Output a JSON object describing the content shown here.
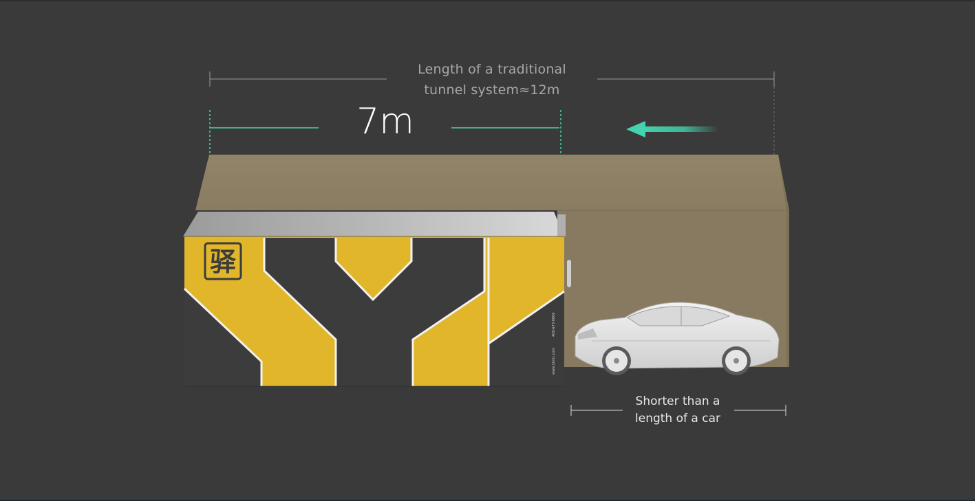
{
  "annotations": {
    "traditional_length_line1": "Length of a traditional",
    "traditional_length_line2": "tunnel system≈12m",
    "compact_length": "7m",
    "car_compare_line1": "Shorter than a",
    "car_compare_line2": "length of a car"
  },
  "logo": {
    "glyph": "驿"
  },
  "unit_side_text": {
    "website": "www.1kmc.com",
    "phone": "400-673-0006"
  },
  "colors": {
    "background": "#3a3a3a",
    "accent_teal": "#44d3ae",
    "brand_yellow": "#e1b62a",
    "brand_dark": "#3c3c3c",
    "tunnel_box": "#8a7c65"
  }
}
